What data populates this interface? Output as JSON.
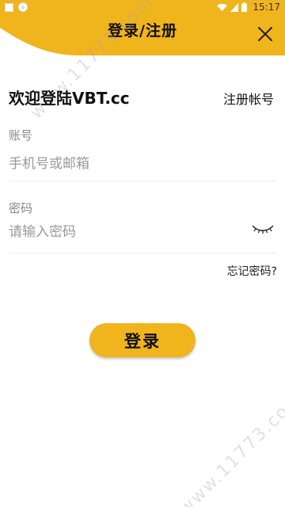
{
  "status_bar": {
    "time": "15:17"
  },
  "header": {
    "title": "登录/注册",
    "bg_color": "#f0b41d"
  },
  "welcome": {
    "text": "欢迎登陆VBT.cc",
    "register_label": "注册帐号"
  },
  "account": {
    "label": "账号",
    "placeholder": "手机号或邮箱"
  },
  "password": {
    "label": "密码",
    "placeholder": "请输入密码"
  },
  "forgot_label": "忘记密码?",
  "login_label": "登录",
  "watermark": "www.11773.com",
  "icons": {
    "close": "close-icon",
    "eye": "eye-closed-icon",
    "wifi": "wifi-icon",
    "signal": "signal-icon",
    "battery": "battery-icon"
  }
}
